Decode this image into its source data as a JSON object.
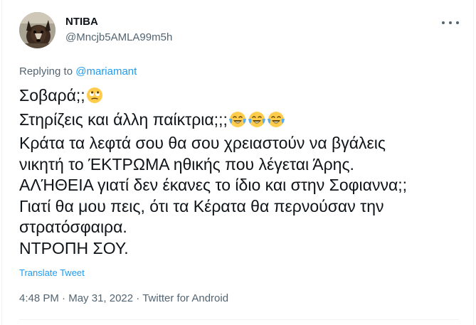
{
  "author": {
    "display_name": "NTIBA",
    "handle": "@Mncjb5AMLA99m5h",
    "avatar_icon": "dog-photo-avatar"
  },
  "reply": {
    "prefix": "Replying to ",
    "mention": "@mariamant"
  },
  "tweet": {
    "lines": [
      "Σοβαρά;;",
      "Στηρίζεις και άλλη παίκτρια;;;",
      "Κράτα τα λεφτά σου θα σου χρειαστούν να βγάλεις",
      "νικητή το ΈΚΤΡΩΜΑ ηθικής που λέγεται Άρης.",
      "ΑΛΉΘΕΙΑ γιατί δεν έκανες το ίδιο και στην Σοφιαννα;;",
      "Γιατί θα μου πεις, ότι τα Κέρατα θα περνούσαν την",
      "στρατόσφαιρα.",
      "ΝΤΡΟΠΗ ΣΟΥ."
    ],
    "emoji": {
      "line0": [
        "face-with-rolling-eyes"
      ],
      "line1": [
        "face-with-tears-of-joy",
        "face-with-tears-of-joy",
        "face-with-tears-of-joy"
      ]
    }
  },
  "translate_label": "Translate Tweet",
  "meta": {
    "time": "4:48 PM",
    "sep1": " · ",
    "date": "May 31, 2022",
    "sep2": " · ",
    "source": "Twitter for Android"
  },
  "colors": {
    "text": "#0f1419",
    "secondary": "#536471",
    "accent": "#1d9bf0",
    "divider": "#eff3f4",
    "emoji_yellow": "#ffcc4d",
    "emoji_tear": "#5dadec"
  },
  "more_icon": "more-horizontal-icon"
}
